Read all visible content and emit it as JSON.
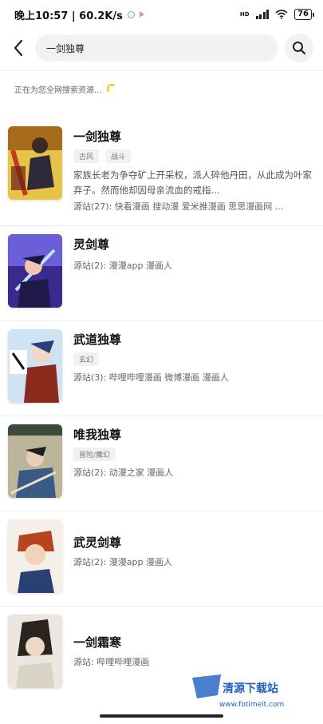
{
  "status": {
    "time_speed": "晚上10:57 | 60.2K/s",
    "network": "HD",
    "battery": "76"
  },
  "search": {
    "query": "一剑独尊"
  },
  "searching_text": "正在为您全网搜索资源...",
  "results": [
    {
      "title": "一剑独尊",
      "tags": [
        "古风",
        "战斗"
      ],
      "desc": "家族长老为争夺矿上开采权，派人碎他丹田，从此成为叶家弃子。然而他却因母亲流血的戒指...",
      "source": "源站(27): 快看漫画 搜动漫 爱米推漫画 思思漫画网 ..."
    },
    {
      "title": "灵剑尊",
      "tags": [],
      "desc": "",
      "source": "源站(2): 漫漫app 漫画人"
    },
    {
      "title": "武道独尊",
      "tags": [
        "玄幻"
      ],
      "desc": "",
      "source": "源站(3): 哔哩哔哩漫画 微博漫画 漫画人"
    },
    {
      "title": "唯我独尊",
      "tags": [
        "冒险/魔幻"
      ],
      "desc": "",
      "source": "源站(2): 动漫之家 漫画人"
    },
    {
      "title": "武灵剑尊",
      "tags": [],
      "desc": "",
      "source": "源站(2): 漫漫app 漫画人"
    },
    {
      "title": "一剑霜寒",
      "tags": [],
      "desc": "",
      "source": "源站: 哔哩哔哩漫画"
    }
  ],
  "watermark": {
    "name": "清源下载站",
    "url": "www.fotimeit.com"
  },
  "icons": {
    "back": "back-arrow-icon",
    "search": "search-icon",
    "spinner": "loading-spinner-icon",
    "wifi": "wifi-icon",
    "battery": "battery-icon"
  }
}
